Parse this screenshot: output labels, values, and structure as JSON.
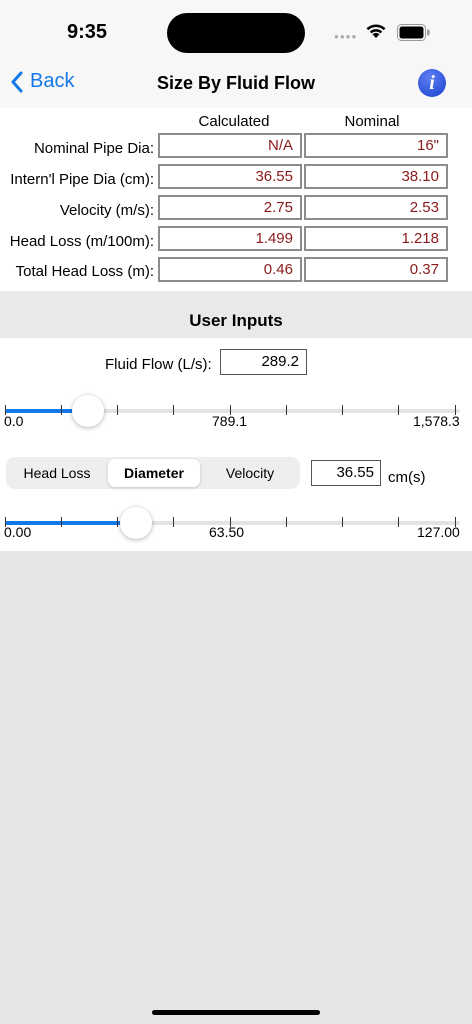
{
  "status_bar": {
    "time": "9:35"
  },
  "nav": {
    "back_label": "Back",
    "title": "Size By Fluid Flow",
    "info_glyph": "i"
  },
  "results": {
    "headers": [
      "Calculated",
      "Nominal"
    ],
    "rows": [
      {
        "label": "Nominal Pipe Dia:",
        "calculated": "N/A",
        "nominal": "16\""
      },
      {
        "label": "Intern'l Pipe Dia (cm):",
        "calculated": "36.55",
        "nominal": "38.10"
      },
      {
        "label": "Velocity (m/s):",
        "calculated": "2.75",
        "nominal": "2.53"
      },
      {
        "label": "Head Loss (m/100m):",
        "calculated": "1.499",
        "nominal": "1.218"
      },
      {
        "label": "Total Head Loss (m):",
        "calculated": "0.46",
        "nominal": "0.37"
      }
    ]
  },
  "user_inputs": {
    "title": "User Inputs",
    "fluid_flow_label": "Fluid Flow (L/s):",
    "fluid_flow_value": "289.2",
    "flow_slider": {
      "min_label": "0.0",
      "mid_label": "789.1",
      "max_label": "1,578.3",
      "fraction": 0.183
    },
    "segments": [
      "Head Loss",
      "Diameter",
      "Velocity"
    ],
    "selected_segment": "Diameter",
    "diameter_value": "36.55",
    "diameter_unit": "cm(s)",
    "diameter_slider": {
      "min_label": "0.00",
      "mid_label": "63.50",
      "max_label": "127.00",
      "fraction": 0.288
    }
  },
  "colors": {
    "accent": "#1479e8",
    "value_text": "#8b1a1a",
    "info_button": "#2a4fd6"
  }
}
